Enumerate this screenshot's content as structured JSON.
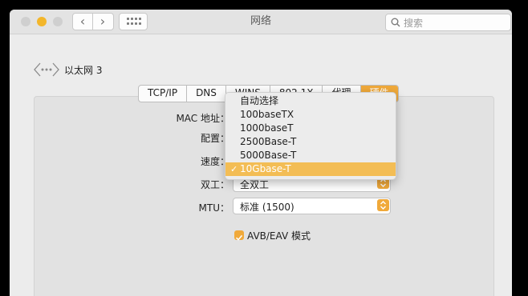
{
  "window": {
    "title": "网络"
  },
  "search": {
    "placeholder": "搜索"
  },
  "interface": {
    "name": "以太网 3"
  },
  "tabs": [
    {
      "label": "TCP/IP"
    },
    {
      "label": "DNS"
    },
    {
      "label": "WINS"
    },
    {
      "label": "802.1X"
    },
    {
      "label": "代理"
    },
    {
      "label": "硬件"
    }
  ],
  "form": {
    "mac_label": "MAC 地址：",
    "config_label": "配置：",
    "speed_label": "速度：",
    "duplex_label": "双工：",
    "duplex_value": "全双工",
    "mtu_label": "MTU：",
    "mtu_value": "标准 (1500)",
    "avb_label": "AVB/EAV 模式",
    "avb_checked": true
  },
  "speed_menu": {
    "options": [
      "自动选择",
      "100baseTX",
      "1000baseT",
      "2500Base-T",
      "5000Base-T",
      "10Gbase-T"
    ],
    "selected": "10Gbase-T",
    "check_mark": "✓"
  },
  "colors": {
    "accent": "#f0a93a",
    "highlight": "#f3bd55"
  }
}
